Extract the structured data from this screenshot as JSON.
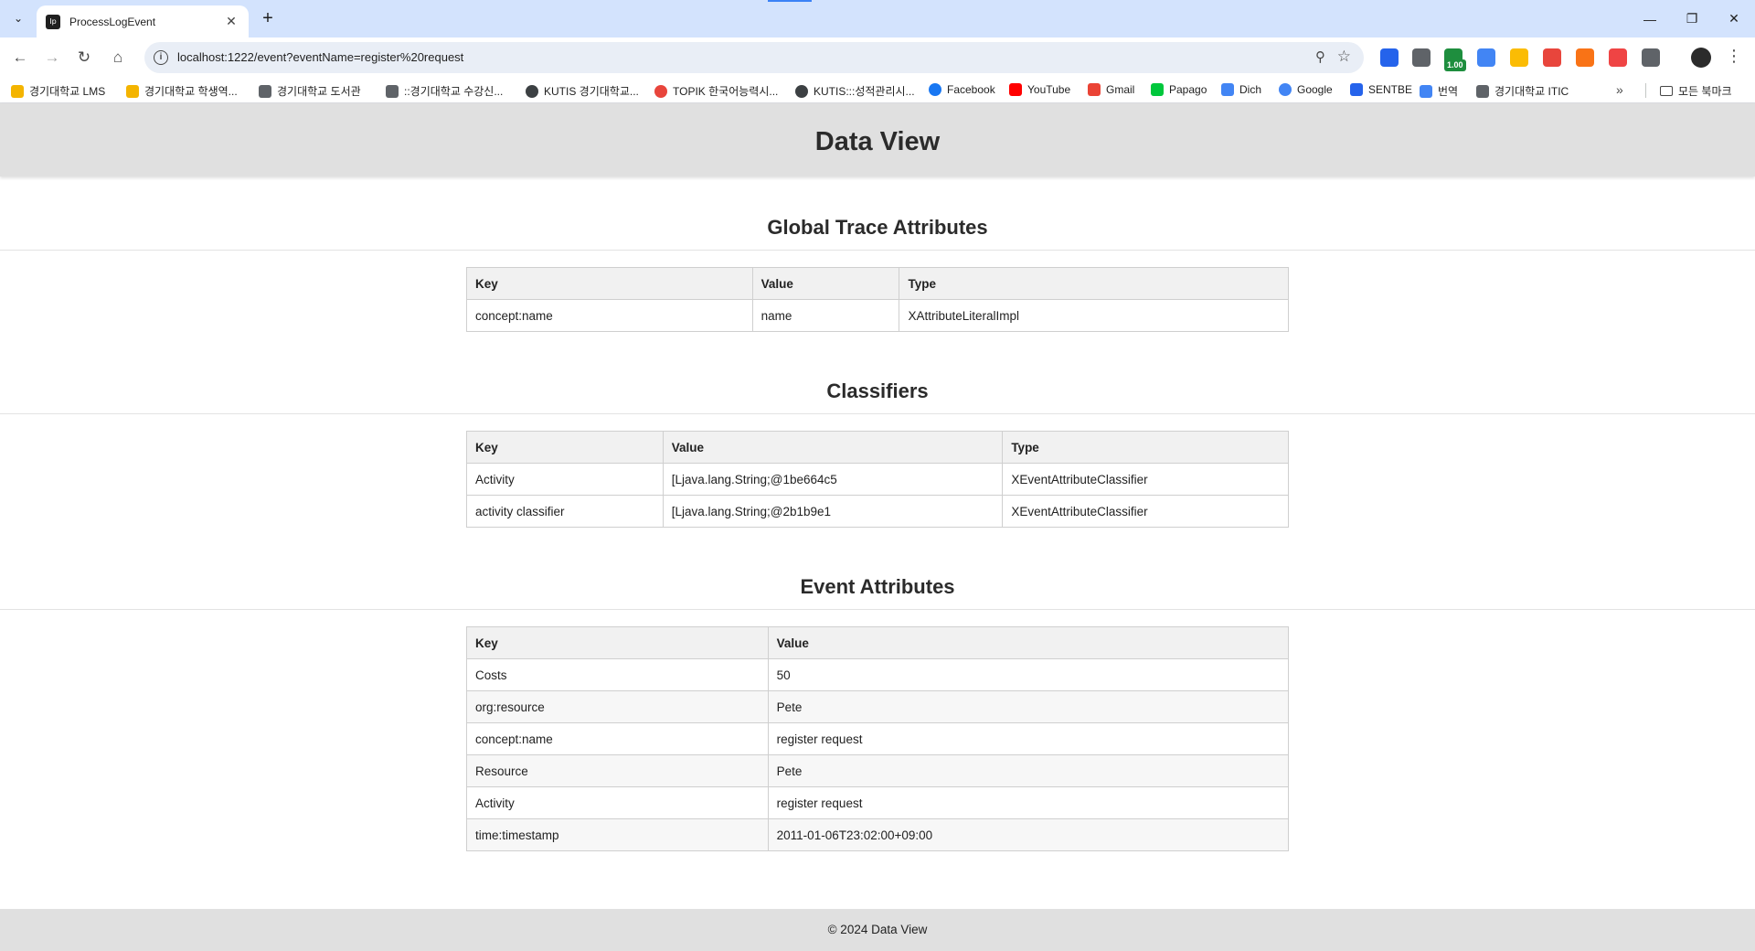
{
  "browser": {
    "tab_title": "ProcessLogEvent",
    "favicon_label": "Ip",
    "url": "localhost:1222/event?eventName=register%20request",
    "extension_badge": "1.00",
    "bookmarks": [
      {
        "label": "경기대학교 LMS",
        "color": "#f4b400"
      },
      {
        "label": "경기대학교 학생역...",
        "color": "#f4b400"
      },
      {
        "label": "경기대학교 도서관",
        "color": "#5f6368"
      },
      {
        "label": "::경기대학교 수강신...",
        "color": "#5f6368"
      },
      {
        "label": "KUTIS 경기대학교...",
        "color": "#3c4043"
      },
      {
        "label": "TOPIK 한국어능력시...",
        "color": "#e8453c"
      },
      {
        "label": "KUTIS:::성적관리시...",
        "color": "#3c4043"
      },
      {
        "label": "Facebook",
        "color": "#1877f2"
      },
      {
        "label": "YouTube",
        "color": "#ff0000"
      },
      {
        "label": "Gmail",
        "color": "#ea4335"
      },
      {
        "label": "Papago",
        "color": "#00c73c"
      },
      {
        "label": "Dich",
        "color": "#4285f4"
      },
      {
        "label": "Google",
        "color": "#4285f4"
      },
      {
        "label": "SENTBE",
        "color": "#2563eb"
      },
      {
        "label": "번역",
        "color": "#4285f4"
      },
      {
        "label": "경기대학교 ITIC",
        "color": "#5f6368"
      }
    ],
    "all_bookmarks_label": "모든 북마크"
  },
  "page": {
    "header_title": "Data View",
    "global_trace": {
      "title": "Global Trace Attributes",
      "headers": [
        "Key",
        "Value",
        "Type"
      ],
      "rows": [
        [
          "concept:name",
          "name",
          "XAttributeLiteralImpl"
        ]
      ]
    },
    "classifiers": {
      "title": "Classifiers",
      "headers": [
        "Key",
        "Value",
        "Type"
      ],
      "rows": [
        [
          "Activity",
          "[Ljava.lang.String;@1be664c5",
          "XEventAttributeClassifier"
        ],
        [
          "activity classifier",
          "[Ljava.lang.String;@2b1b9e1",
          "XEventAttributeClassifier"
        ]
      ]
    },
    "event_attributes": {
      "title": "Event Attributes",
      "headers": [
        "Key",
        "Value"
      ],
      "rows": [
        [
          "Costs",
          "50"
        ],
        [
          "org:resource",
          "Pete"
        ],
        [
          "concept:name",
          "register request"
        ],
        [
          "Resource",
          "Pete"
        ],
        [
          "Activity",
          "register request"
        ],
        [
          "time:timestamp",
          "2011-01-06T23:02:00+09:00"
        ]
      ]
    },
    "footer": "© 2024 Data View"
  }
}
